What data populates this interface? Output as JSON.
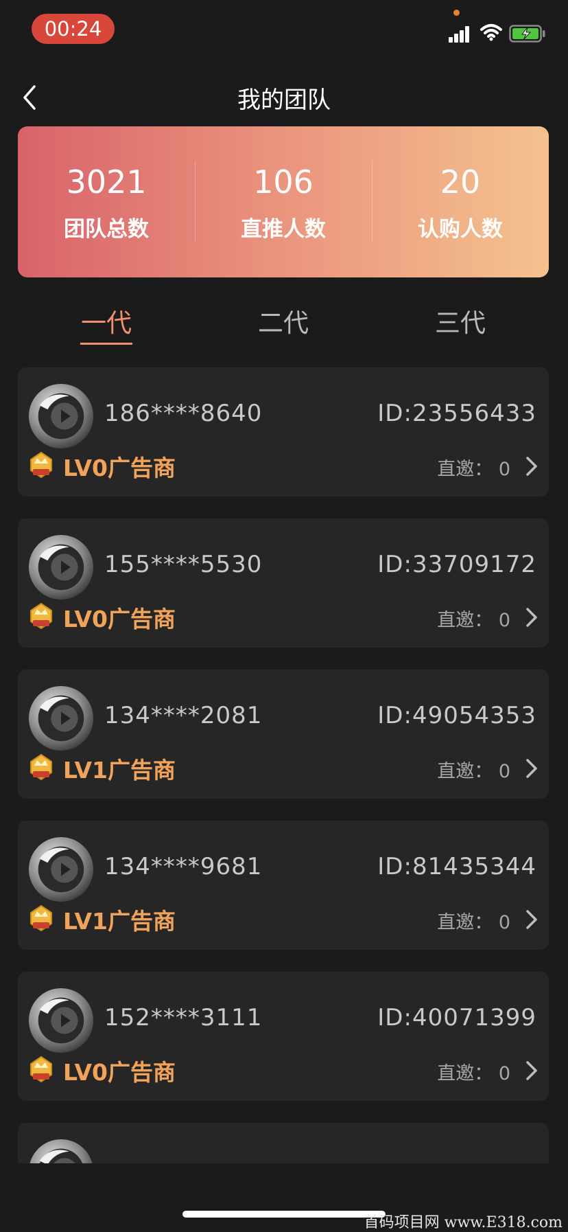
{
  "status_bar": {
    "time": "00:24"
  },
  "header": {
    "title": "我的团队"
  },
  "stats": [
    {
      "value": "3021",
      "label": "团队总数"
    },
    {
      "value": "106",
      "label": "直推人数"
    },
    {
      "value": "20",
      "label": "认购人数"
    }
  ],
  "tabs": [
    {
      "label": "一代",
      "active": true
    },
    {
      "label": "二代",
      "active": false
    },
    {
      "label": "三代",
      "active": false
    }
  ],
  "members": [
    {
      "phone": "186****8640",
      "id": "ID:23556433",
      "level": "LV0广告商",
      "invite_label": "直邀：",
      "invite_count": "0"
    },
    {
      "phone": "155****5530",
      "id": "ID:33709172",
      "level": "LV0广告商",
      "invite_label": "直邀：",
      "invite_count": "0"
    },
    {
      "phone": "134****2081",
      "id": "ID:49054353",
      "level": "LV1广告商",
      "invite_label": "直邀：",
      "invite_count": "0"
    },
    {
      "phone": "134****9681",
      "id": "ID:81435344",
      "level": "LV1广告商",
      "invite_label": "直邀：",
      "invite_count": "0"
    },
    {
      "phone": "152****3111",
      "id": "ID:40071399",
      "level": "LV0广告商",
      "invite_label": "直邀：",
      "invite_count": "0"
    },
    {
      "phone": "",
      "id": "",
      "level": "",
      "invite_label": "",
      "invite_count": ""
    }
  ],
  "watermark": "首码项目网 www.E318.com",
  "colors": {
    "accent": "#f2906e",
    "level": "#f2a35a",
    "card": "#262626",
    "background": "#1b1b1b"
  }
}
